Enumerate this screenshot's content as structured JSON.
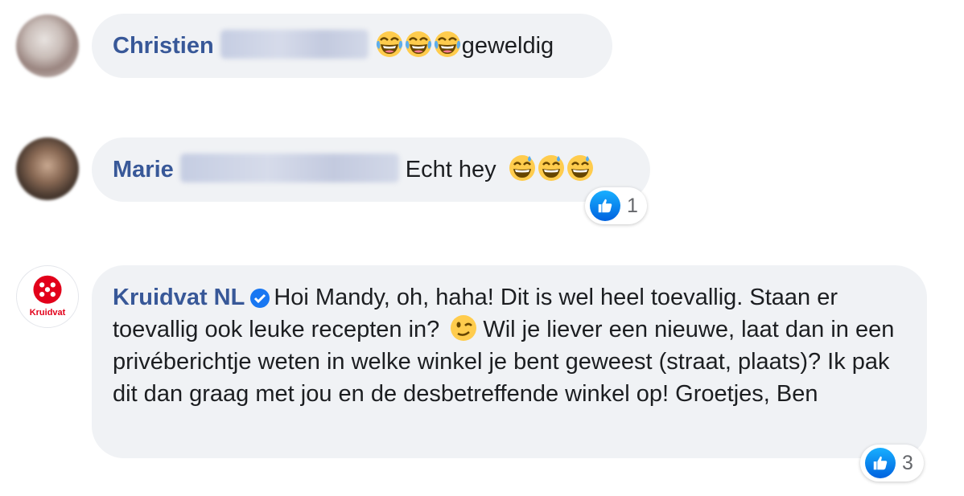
{
  "comments": [
    {
      "author_first": "Christien",
      "text": "geweldig",
      "emoji": [
        "laughing-tears",
        "laughing-tears",
        "laughing-tears"
      ]
    },
    {
      "author_first": "Marie",
      "text": "Echt hey",
      "emoji": [
        "grinning-sweat",
        "grinning-sweat",
        "grinning-sweat"
      ],
      "reactions": "1"
    },
    {
      "author": "Kruidvat NL",
      "text_before_emoji": "Hoi Mandy, oh, haha! Dit is wel heel toevallig. Staan er toevallig ook leuke recepten in?",
      "text_after_emoji": "Wil je liever een nieuwe, laat dan in een privéberichtje weten in welke winkel je bent geweest (straat, plaats)? Ik pak dit dan graag met jou en de desbetreffende winkel op! Groetjes, Ben",
      "emoji": [
        "winking-face"
      ],
      "reactions": "3",
      "logo_text": "Kruidvat"
    }
  ],
  "colors": {
    "author_link": "#385898",
    "bubble_bg": "#f0f2f5",
    "like_blue": "#1877f2",
    "kruidvat_red": "#e2001a"
  }
}
